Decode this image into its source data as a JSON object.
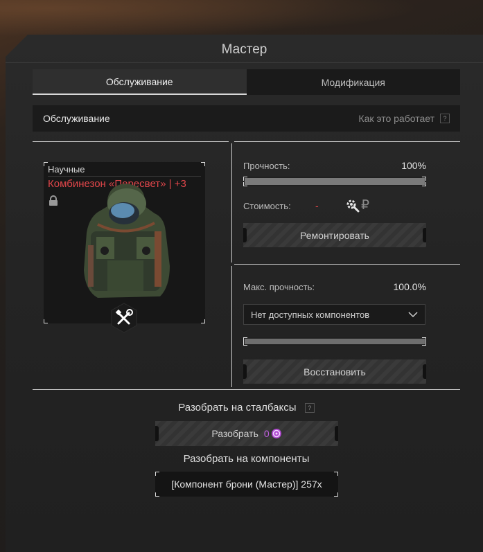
{
  "window": {
    "title": "Мастер"
  },
  "tabs": [
    {
      "label": "Обслуживание",
      "active": true
    },
    {
      "label": "Модификация",
      "active": false
    }
  ],
  "section": {
    "title": "Обслуживание",
    "help_link": "Как это работает",
    "help_icon": "?"
  },
  "item": {
    "category": "Научные",
    "name": "Комбинезон «Пересвет» | +3",
    "name_color": "#e0464a",
    "lock_icon": "lock-icon",
    "badge_icon": "wrench-screwdriver-icon"
  },
  "repair": {
    "durability_label": "Прочность:",
    "durability_value": "100%",
    "durability_fraction": 1.0,
    "cost_label": "Стоимость:",
    "cost_value": "-",
    "cost_value_color": "#e0464a",
    "cost_icons": [
      "gear-search-icon",
      "ruble-icon"
    ],
    "ruble_symbol": "₽",
    "button_label": "Ремонтировать"
  },
  "restore": {
    "max_label": "Макс. прочность:",
    "max_value": "100.0%",
    "max_fraction": 1.0,
    "dropdown_value": "Нет доступных компонентов",
    "button_label": "Восстановить"
  },
  "disassemble": {
    "stalbox_label": "Разобрать на сталбаксы",
    "help_icon": "?",
    "button_label": "Разобрать",
    "button_amount": "0",
    "amount_color": "#c060e0",
    "components_label": "Разобрать на компоненты",
    "component_text": "[Компонент брони (Мастер)] 257x"
  }
}
